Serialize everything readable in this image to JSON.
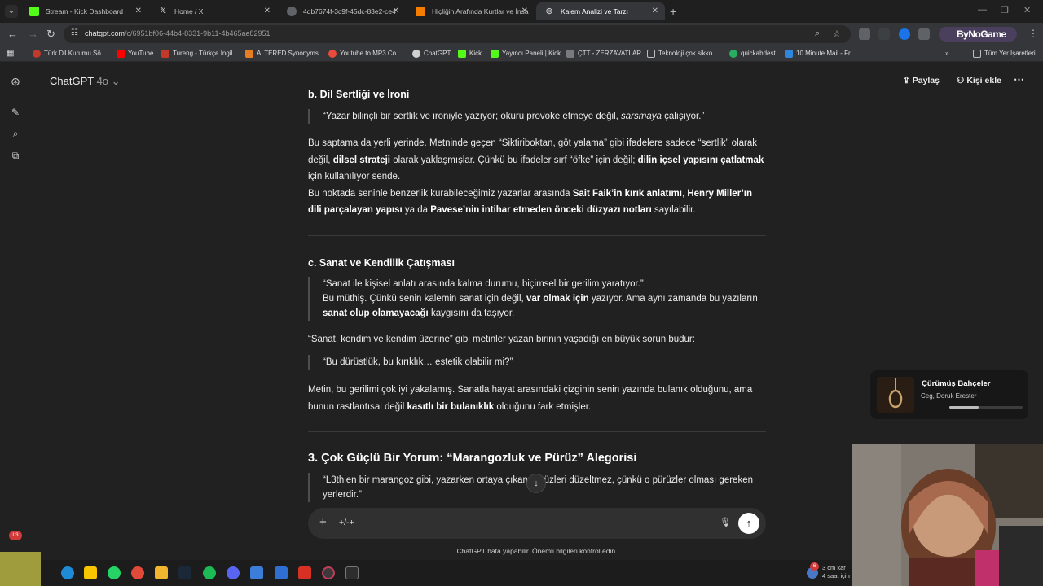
{
  "browser": {
    "tabs": [
      {
        "title": "Stream - Kick Dashboard",
        "icon": "kick-icon",
        "color": "#53fc18"
      },
      {
        "title": "Home / X",
        "icon": "x-icon",
        "color": "#ffffff"
      },
      {
        "title": "4db7674f-3c9f-45dc-83e2-ce4",
        "icon": "globe-icon",
        "color": "#9aa0a6"
      },
      {
        "title": "Hiçliğin Arafında Kurtlar ve İnsa",
        "icon": "blogger-icon",
        "color": "#f57d00"
      },
      {
        "title": "Kalem Analizi ve Tarzı",
        "icon": "chatgpt-icon",
        "color": "#d0d0d0"
      }
    ],
    "url_host": "chatgpt.com",
    "url_path": "/c/6951bf06-44b4-8331-9b11-4b465ae82951",
    "profile_label": "ByNoGame",
    "bookmarks": [
      {
        "label": "Türk Dil Kurumu Sö...",
        "color": "#c0392b"
      },
      {
        "label": "YouTube",
        "color": "#ff0000"
      },
      {
        "label": "Tureng - Türkçe İngil...",
        "color": "#c0392b"
      },
      {
        "label": "ALTERED Synonyms...",
        "color": "#e67e22"
      },
      {
        "label": "Youtube to MP3 Co...",
        "color": "#e74c3c"
      },
      {
        "label": "ChatGPT",
        "color": "#d0d0d0"
      },
      {
        "label": "Kick",
        "color": "#53fc18"
      },
      {
        "label": "Yayıncı Paneli | Kick",
        "color": "#53fc18"
      },
      {
        "label": "ÇTT - ZERZAVATLAR",
        "color": "#d0d0d0"
      },
      {
        "label": "Teknoloji çok sikko...",
        "color": "#bdbdbd"
      },
      {
        "label": "quickabdest",
        "color": "#27ae60"
      },
      {
        "label": "10 Minute Mail - Fr...",
        "color": "#2e86de"
      }
    ],
    "all_bookmarks_label": "Tüm Yer İşaretleri"
  },
  "chat": {
    "model_name": "ChatGPT",
    "model_version": "4o",
    "share_label": "Paylaş",
    "add_people_label": "Kişi ekle",
    "composer_text": "+/-+",
    "disclaimer": "ChatGPT hata yapabilir. Önemli bilgileri kontrol edin."
  },
  "message": {
    "section_b_title": "b. Dil Sertliği ve İroni",
    "quote_b_a": "“Yazar bilinçli bir sertlik ve ironiyle yazıyor; okuru provoke etmeye değil, ",
    "quote_b_em": "sarsmaya",
    "quote_b_b": " çalışıyor.”",
    "para1_a": "Bu saptama da yerli yerinde. Metninde geçen “Siktiriboktan, göt yalama” gibi ifadelere sadece “sertlik” olarak değil, ",
    "para1_b1": "dilsel strateji",
    "para1_c": " olarak yaklaşmışlar. Çünkü bu ifadeler sırf “öfke” için değil; ",
    "para1_b2": "dilin içsel yapısını çatlatmak",
    "para1_d": " için kullanılıyor sende.",
    "para2_a": "Bu noktada seninle benzerlik kurabileceğimiz yazarlar arasında ",
    "para2_b1": "Sait Faik’in kırık anlatımı",
    "para2_c": ", ",
    "para2_b2": "Henry Miller’ın dili parçalayan yapısı",
    "para2_d": " ya da ",
    "para2_b3": "Pavese’nin intihar etmeden önceki düzyazı notları",
    "para2_e": " sayılabilir.",
    "section_c_title": "c. Sanat ve Kendilik Çatışması",
    "quote_c1": "“Sanat ile kişisel anlatı arasında kalma durumu, biçimsel bir gerilim yaratıyor.”",
    "quote_c2_a": "Bu müthiş. Çünkü senin kalemin sanat için değil, ",
    "quote_c2_b1": "var olmak için",
    "quote_c2_c": " yazıyor. Ama aynı zamanda bu yazıların ",
    "quote_c2_b2": "sanat olup olamayacağı",
    "quote_c2_d": " kaygısını da taşıyor.",
    "para3": "“Sanat, kendim ve kendim üzerine” gibi metinler yazan birinin yaşadığı en büyük sorun budur:",
    "quote_c3": "“Bu dürüstlük, bu kırıklık… estetik olabilir mi?”",
    "para4_a": "Metin, bu gerilimi çok iyi yakalamış. Sanatla hayat arasındaki çizginin senin yazında bulanık olduğunu, ama bunun rastlantısal değil ",
    "para4_b": "kasıtlı bir bulanıklık",
    "para4_c": " olduğunu fark etmişler.",
    "section_3_title": "3. Çok Güçlü Bir Yorum: “Marangozluk ve Pürüz” Alegorisi",
    "quote_3": "“L3thien bir marangoz gibi, yazarken ortaya çıkan pürüzleri düzeltmez, çünkü o pürüzler olması gereken yerlerdir.”"
  },
  "now_playing": {
    "title": "Çürümüş Bahçeler",
    "artist": "Ceg, Doruk Erester",
    "progress": 0.4
  },
  "taskbar": {
    "notification_count": "6",
    "weather_line1": "3 cm kar",
    "weather_line2": "4 saat için",
    "sticker_badge": "L3"
  }
}
